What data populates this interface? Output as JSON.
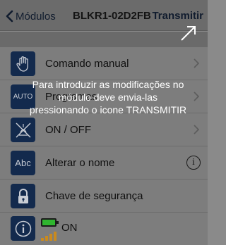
{
  "navbar": {
    "back_label": "Módulos",
    "title": "BLKR1-02D2FB",
    "action_label": "Transmitir"
  },
  "menu": [
    {
      "icon": "hand-icon",
      "label": "Comando manual",
      "accessory": "chevron"
    },
    {
      "icon": "auto-icon",
      "icon_text": "AUTO",
      "label": "Programas",
      "accessory": "chevron"
    },
    {
      "icon": "on-off-light-icon",
      "label": "ON / OFF",
      "accessory": "chevron"
    },
    {
      "icon": "abc-icon",
      "icon_text": "Abc",
      "label": "Alterar o nome",
      "accessory": "info"
    },
    {
      "icon": "lock-icon",
      "label": "Chave de segurança",
      "accessory": "none"
    }
  ],
  "status": {
    "icon": "info-icon",
    "state": "ON",
    "battery_color": "#2fb52f"
  },
  "overlay": {
    "message": "Para introduzir as modificações no módulo deve envia-las pressionando o icone TRANSMITIR"
  },
  "colors": {
    "icon_bg": "#132a4d",
    "accent": "#111c2e"
  }
}
